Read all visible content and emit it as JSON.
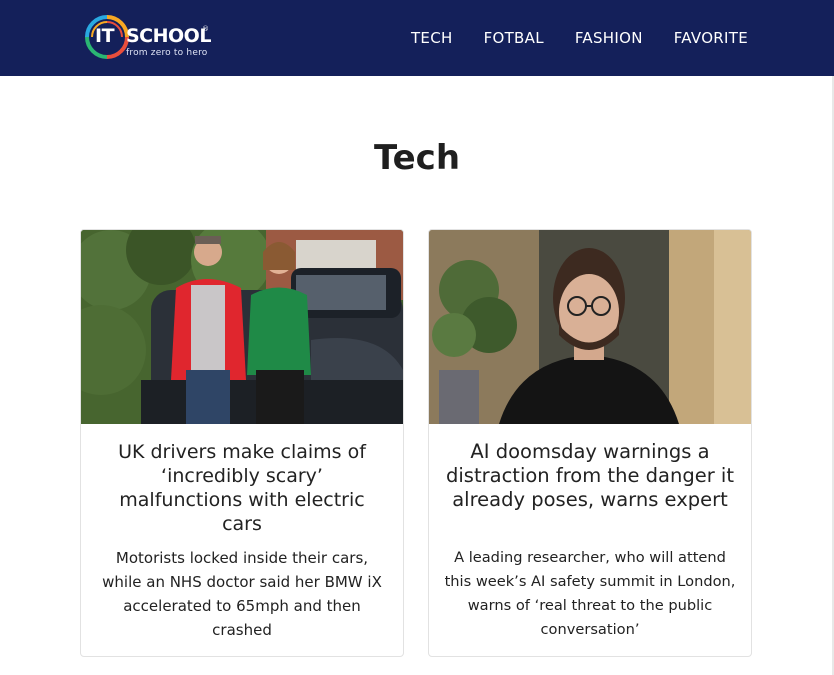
{
  "header": {
    "logo": {
      "it": "IT",
      "school": "SCHOOL",
      "registered": "®",
      "tagline": "from zero to hero"
    },
    "nav": [
      {
        "label": "TECH"
      },
      {
        "label": "FOTBAL"
      },
      {
        "label": "FASHION"
      },
      {
        "label": "FAVORITE"
      }
    ],
    "background_color": "#14205a"
  },
  "main": {
    "title": "Tech",
    "articles": [
      {
        "title": "UK drivers make claims of ‘incredibly scary’ malfunctions with electric cars",
        "description": "Motorists locked inside their cars, while an NHS doctor said her BMW iX accelerated to 65mph and then crashed",
        "image": "couple-with-electric-car-photo"
      },
      {
        "title": "AI doomsday warnings a distraction from the danger it already poses, warns expert",
        "description": "A leading researcher, who will attend this week’s AI safety summit in London, warns of ‘real threat to the public conversation’",
        "image": "researcher-portrait-photo"
      }
    ]
  }
}
